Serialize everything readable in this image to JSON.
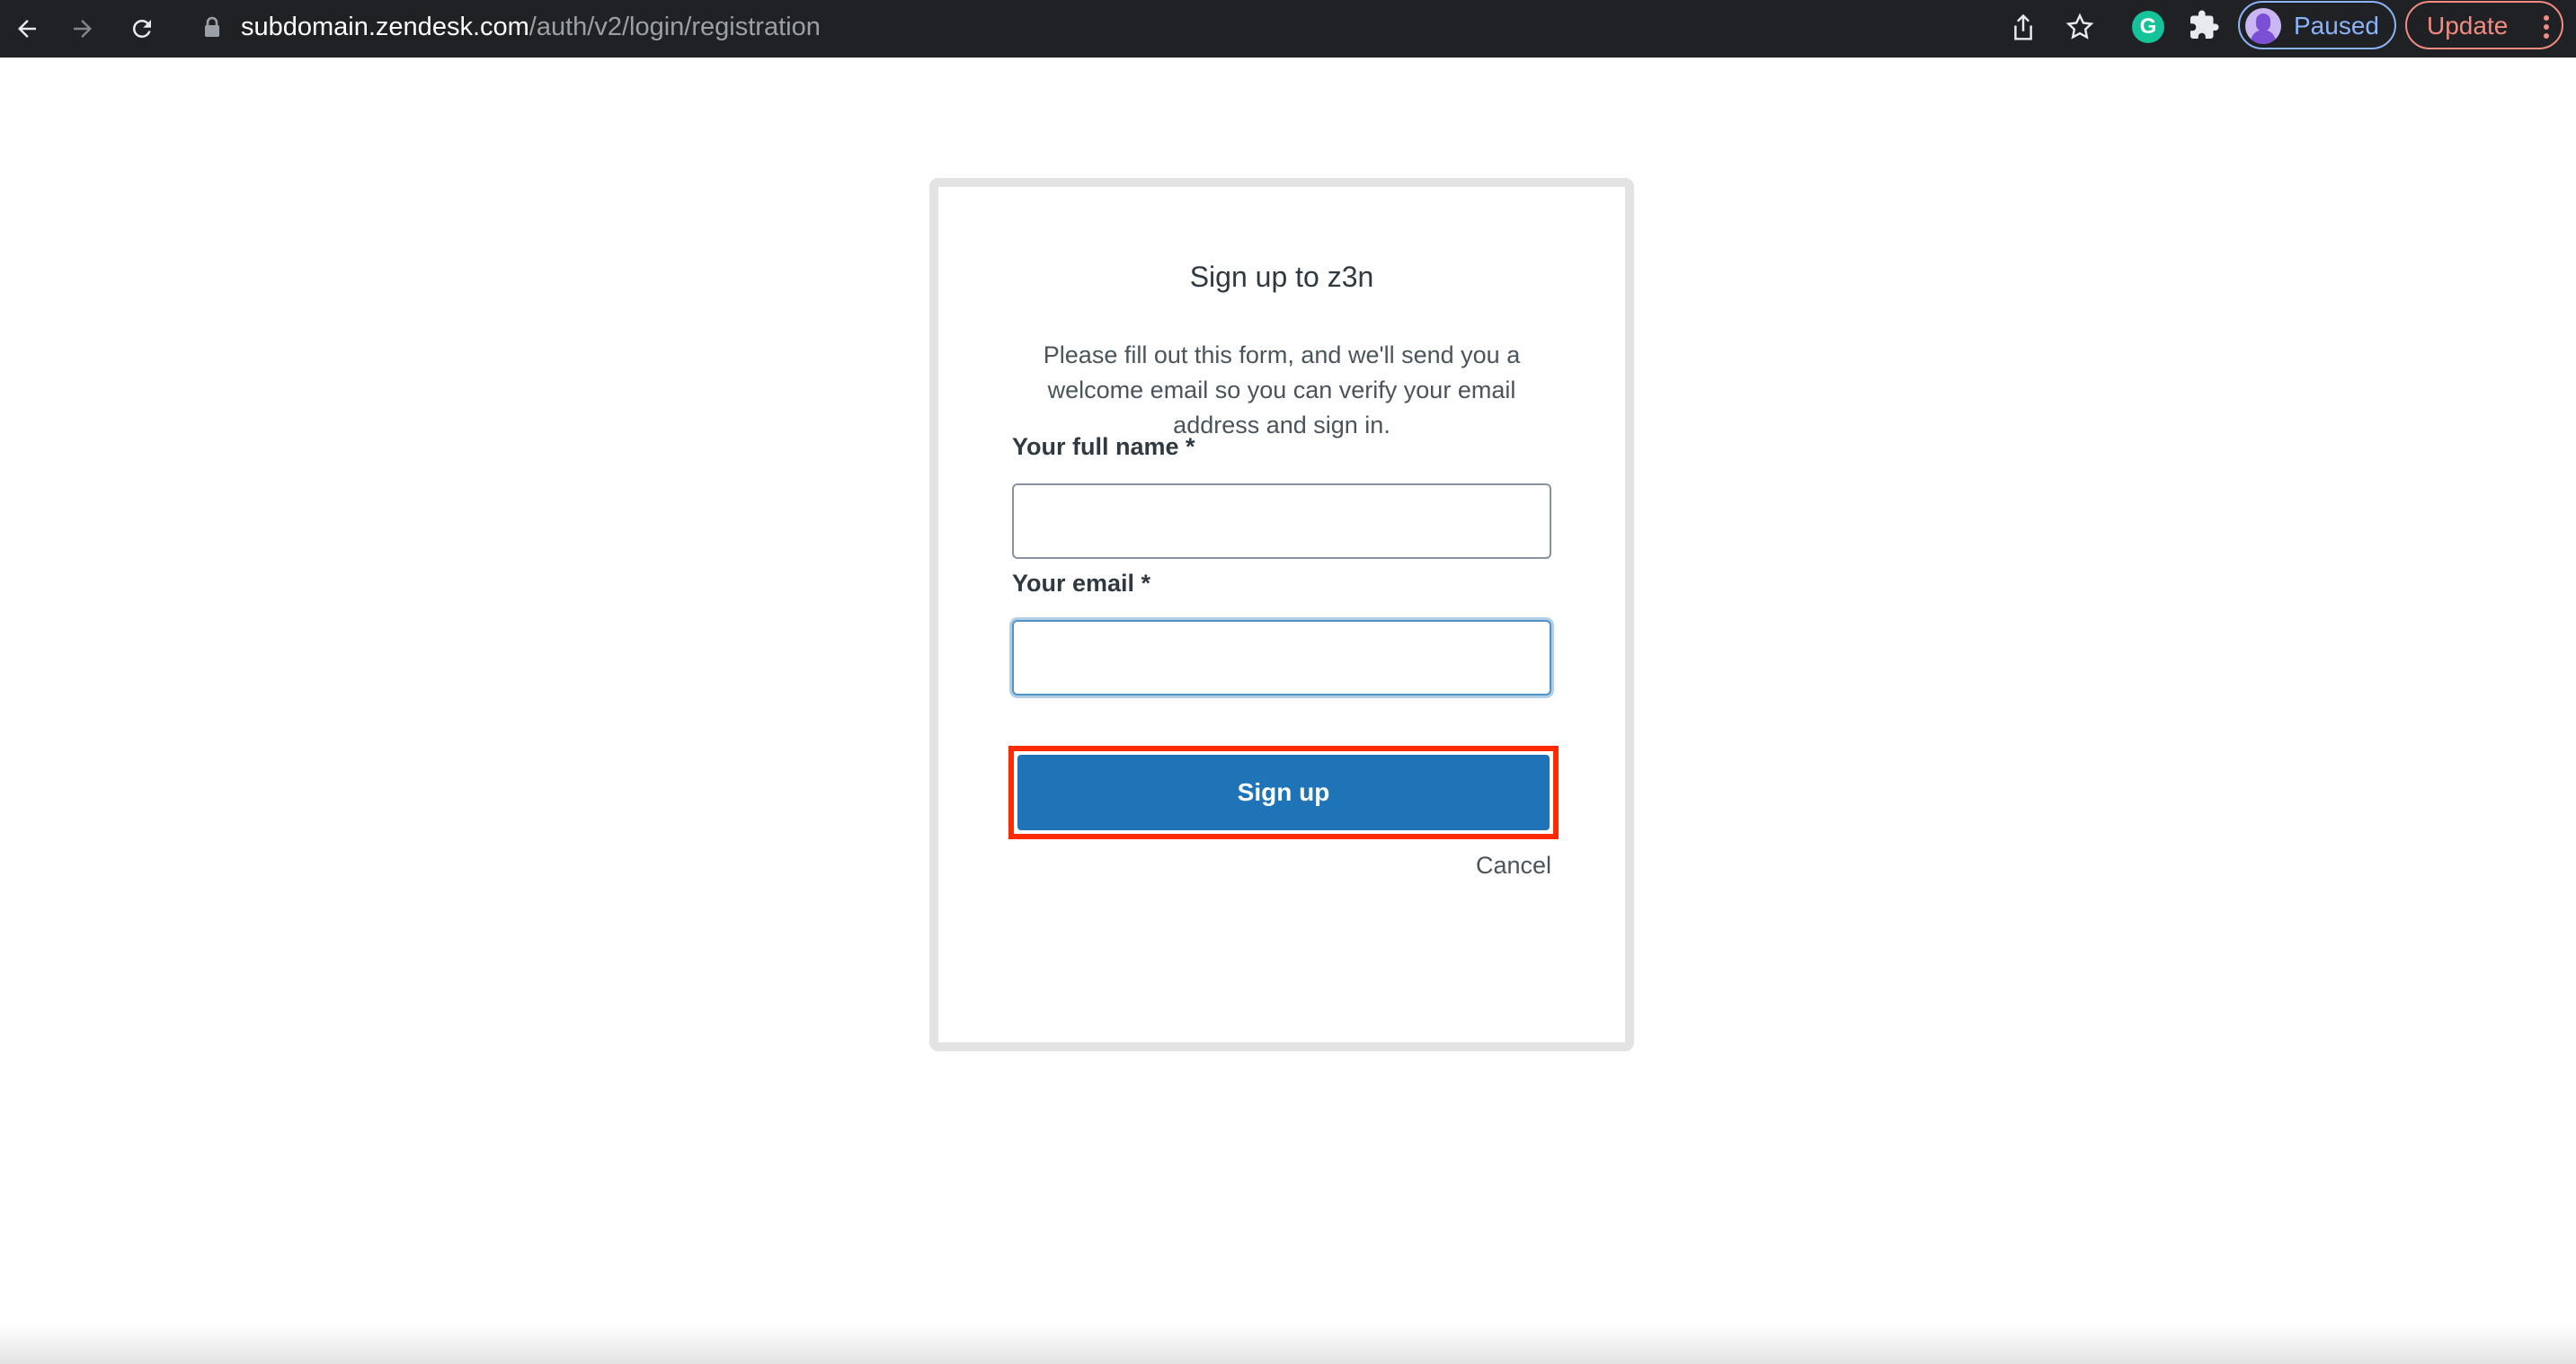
{
  "browser": {
    "url_host": "subdomain.zendesk.com",
    "url_path": "/auth/v2/login/registration",
    "grammarly_letter": "G",
    "profile_label": "Paused",
    "update_label": "Update",
    "icons": {
      "back": "arrow-left-icon",
      "forward": "arrow-right-icon",
      "reload": "reload-icon",
      "lock": "lock-icon",
      "share": "share-icon",
      "bookmark": "star-icon",
      "extensions": "puzzle-icon",
      "menu": "vertical-dots-icon"
    },
    "colors": {
      "toolbar_bg": "#202124",
      "profile_accent": "#8ab4f8",
      "update_accent": "#f28b82",
      "grammarly": "#15c39a"
    }
  },
  "form": {
    "title": "Sign up to z3n",
    "description": "Please fill out this form, and we'll send you a welcome email so you can verify your email address and sign in.",
    "full_name_label": "Your full name *",
    "full_name_value": "",
    "email_label": "Your email *",
    "email_value": "",
    "submit_label": "Sign up",
    "cancel_label": "Cancel",
    "colors": {
      "button": "#1f73b7",
      "highlight": "#ff2a00"
    }
  }
}
